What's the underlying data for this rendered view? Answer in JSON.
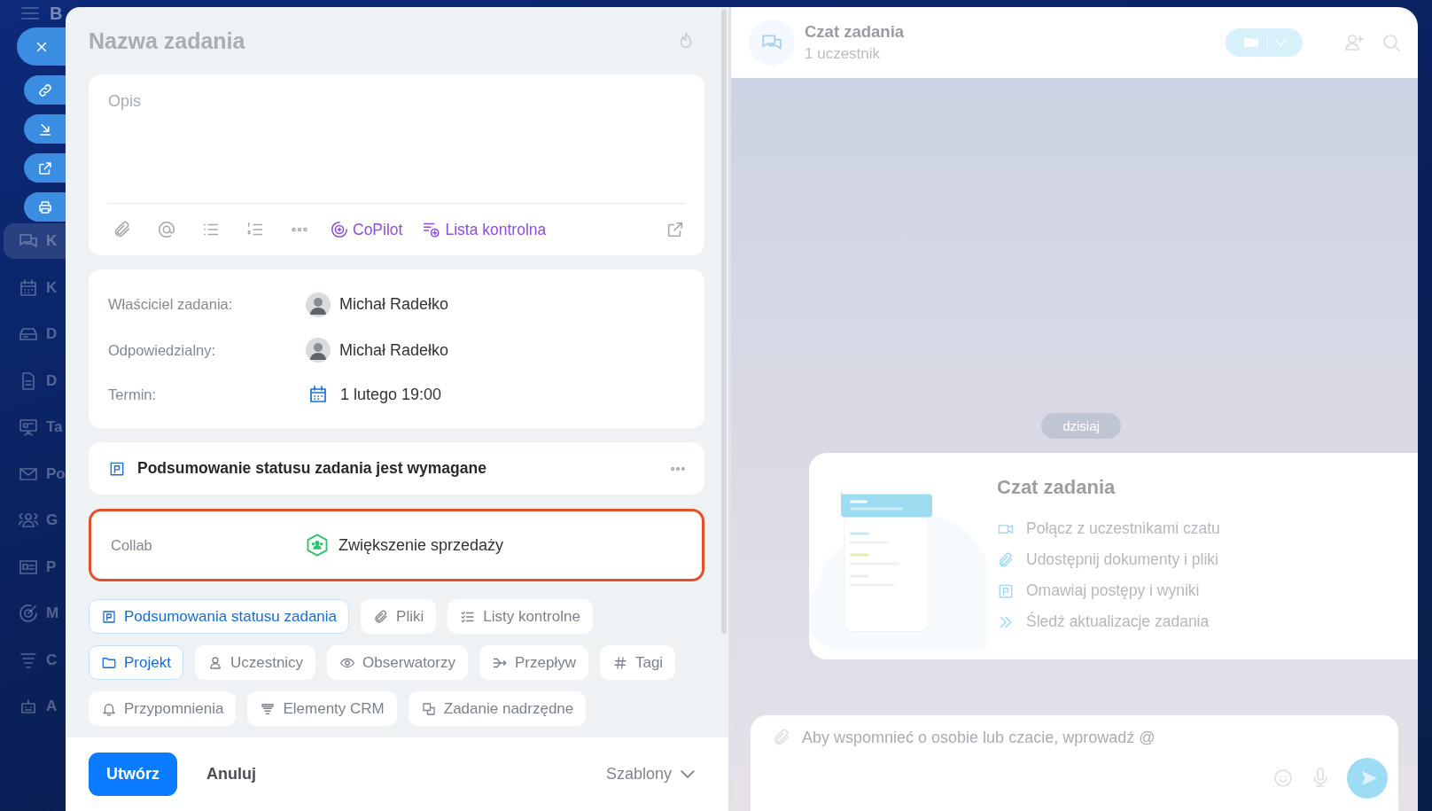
{
  "sidebar": {
    "brand": "B",
    "items": [
      {
        "kind": "chat",
        "label": "K",
        "selected": true
      },
      {
        "kind": "calendar",
        "label": "K",
        "selected": false
      },
      {
        "kind": "drive",
        "label": "D",
        "selected": false
      },
      {
        "kind": "document",
        "label": "D",
        "selected": false
      },
      {
        "kind": "board",
        "label": "Ta",
        "selected": false
      },
      {
        "kind": "mail",
        "label": "Po",
        "selected": false
      },
      {
        "kind": "group",
        "label": "G",
        "selected": false
      },
      {
        "kind": "card",
        "label": "P",
        "selected": false
      },
      {
        "kind": "target",
        "label": "M",
        "selected": false
      },
      {
        "kind": "funnel",
        "label": "C",
        "selected": false
      },
      {
        "kind": "robot",
        "label": "A",
        "selected": false
      }
    ]
  },
  "quick_actions": [
    {
      "kind": "close"
    },
    {
      "kind": "link"
    },
    {
      "kind": "download"
    },
    {
      "kind": "external"
    },
    {
      "kind": "print"
    }
  ],
  "task": {
    "title_placeholder": "Nazwa zadania",
    "description": {
      "placeholder": "Opis",
      "toolbar": [
        {
          "kind": "attach"
        },
        {
          "kind": "mention"
        },
        {
          "kind": "bullets"
        },
        {
          "kind": "numbering"
        },
        {
          "kind": "more"
        },
        {
          "kind": "copilot",
          "label": "CoPilot"
        },
        {
          "kind": "checklist",
          "label": "Lista kontrolna"
        },
        {
          "kind": "expand"
        }
      ]
    },
    "fields": [
      {
        "kind": "person",
        "label": "Właściciel zadania:",
        "value": "Michał Radełko"
      },
      {
        "kind": "person",
        "label": "Odpowiedzialny:",
        "value": "Michał Radełko"
      },
      {
        "kind": "date",
        "label": "Termin:",
        "value": "1 lutego 19:00"
      }
    ],
    "status_summary": {
      "text": "Podsumowanie statusu zadania jest wymagane"
    },
    "collab": {
      "label": "Collab",
      "value": "Zwiększenie sprzedaży",
      "highlighted": true
    },
    "chip_rows": [
      [
        {
          "kind": "status",
          "label": "Podsumowania statusu zadania",
          "selected": true
        },
        {
          "kind": "attach",
          "label": "Pliki",
          "selected": false
        },
        {
          "kind": "checklist-lines",
          "label": "Listy kontrolne",
          "selected": false
        }
      ],
      [
        {
          "kind": "folder",
          "label": "Projekt",
          "selected": true
        },
        {
          "kind": "person",
          "label": "Uczestnicy",
          "selected": false
        },
        {
          "kind": "eye",
          "label": "Obserwatorzy",
          "selected": false
        },
        {
          "kind": "flow",
          "label": "Przepływ",
          "selected": false
        },
        {
          "kind": "hash",
          "label": "Tagi",
          "selected": false
        }
      ],
      [
        {
          "kind": "bell",
          "label": "Przypomnienia",
          "selected": false
        },
        {
          "kind": "crm",
          "label": "Elementy CRM",
          "selected": false
        },
        {
          "kind": "parent",
          "label": "Zadanie nadrzędne",
          "selected": false
        }
      ]
    ],
    "footer": {
      "create": "Utwórz",
      "cancel": "Anuluj",
      "templates": "Szablony"
    }
  },
  "chat": {
    "title": "Czat zadania",
    "subtitle": "1 uczestnik",
    "date": "dzisiaj",
    "intro": {
      "title": "Czat zadania",
      "features": [
        {
          "kind": "video",
          "label": "Połącz z uczestnikami czatu"
        },
        {
          "kind": "attach",
          "label": "Udostępnij dokumenty i pliki"
        },
        {
          "kind": "status",
          "label": "Omawiaj postępy i wyniki"
        },
        {
          "kind": "forward",
          "label": "Śledź aktualizacje zadania"
        }
      ]
    },
    "input": {
      "placeholder": "Aby wspomnieć o osobie lub czacie, wprowadź @"
    }
  }
}
